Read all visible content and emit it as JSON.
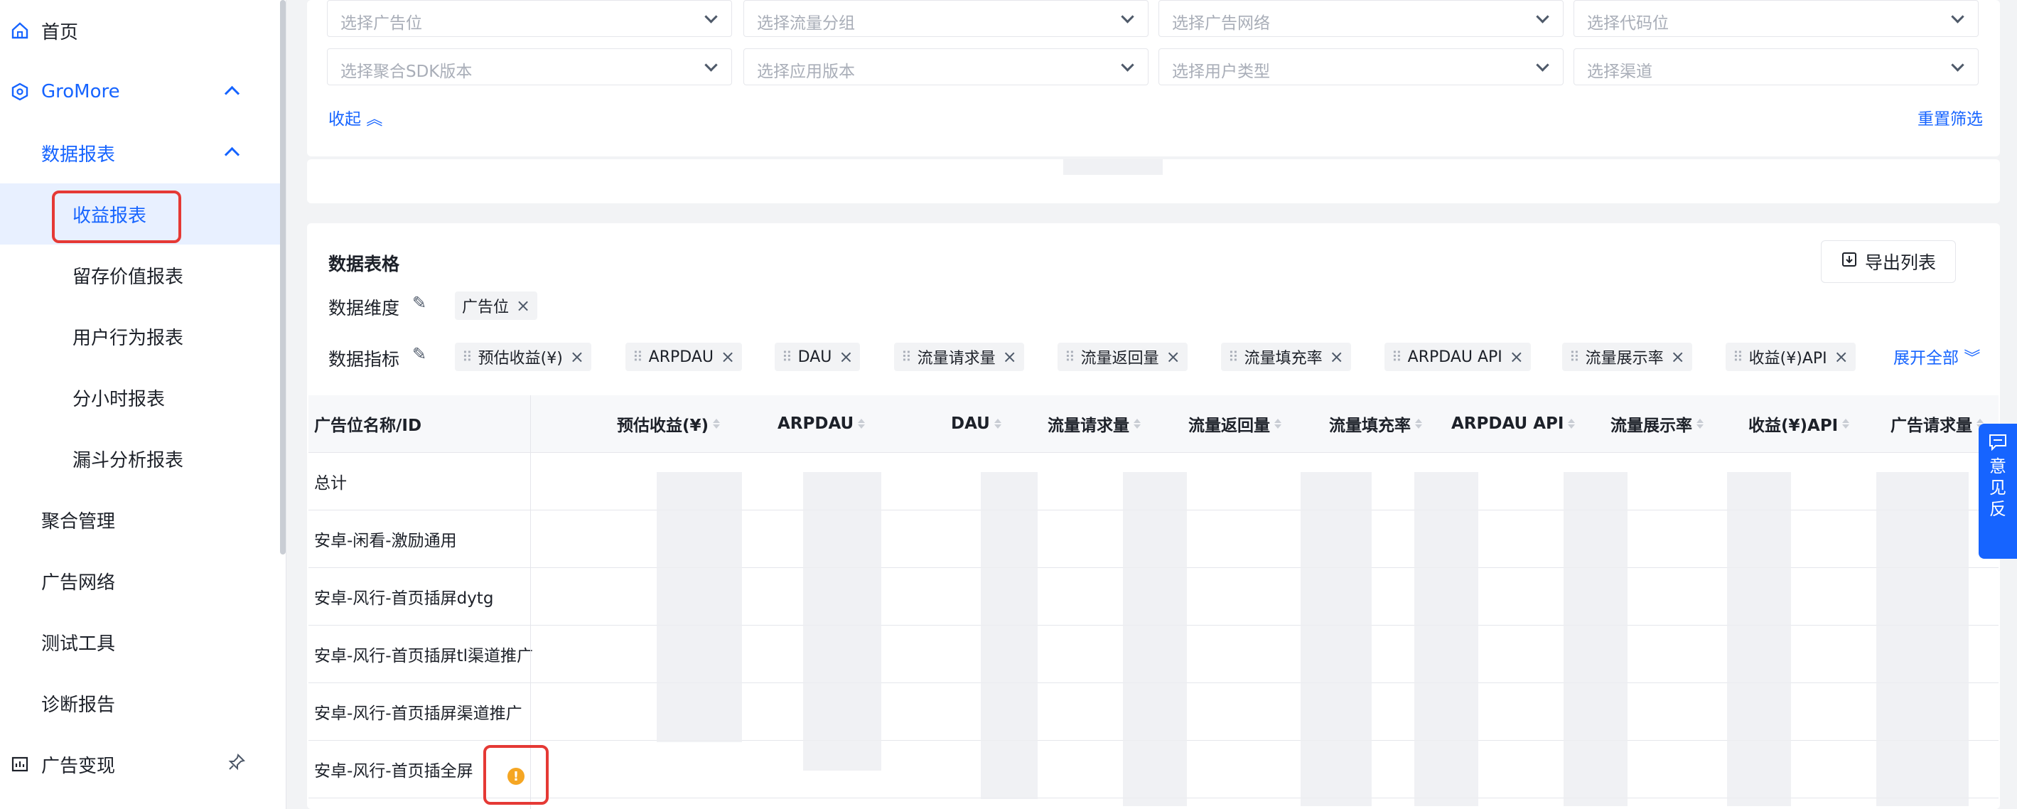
{
  "sidebar": {
    "home": "首页",
    "gromore": "GroMore",
    "data_reports": "数据报表",
    "income_report": "收益报表",
    "retention_report": "留存价值报表",
    "user_behavior_report": "用户行为报表",
    "hourly_report": "分小时报表",
    "funnel_report": "漏斗分析报表",
    "mediation": "聚合管理",
    "ad_network": "广告网络",
    "test_tools": "测试工具",
    "diagnosis": "诊断报告",
    "ad_monetization": "广告变现"
  },
  "filters": {
    "row1": [
      "选择广告位",
      "选择流量分组",
      "选择广告网络",
      "选择代码位"
    ],
    "row2": [
      "选择聚合SDK版本",
      "选择应用版本",
      "选择用户类型",
      "选择渠道"
    ],
    "collapse": "收起",
    "reset": "重置筛选"
  },
  "table_card": {
    "title": "数据表格",
    "export": "导出列表",
    "dimension_label": "数据维度",
    "dimension_tag": "广告位",
    "metric_label": "数据指标",
    "metrics": [
      "预估收益(¥)",
      "ARPDAU",
      "DAU",
      "流量请求量",
      "流量返回量",
      "流量填充率",
      "ARPDAU API",
      "流量展示率",
      "收益(¥)API"
    ],
    "expand_all": "展开全部"
  },
  "table": {
    "first_col": "广告位名称/ID",
    "columns": [
      "预估收益(¥)",
      "ARPDAU",
      "DAU",
      "流量请求量",
      "流量返回量",
      "流量填充率",
      "ARPDAU API",
      "流量展示率",
      "收益(¥)API",
      "广告请求量"
    ],
    "rows": [
      "总计",
      "安卓-闲看-激励通用",
      "安卓-风行-首页插屏dytg",
      "安卓-风行-首页插屏tl渠道推广",
      "安卓-风行-首页插屏渠道推广",
      "安卓-风行-首页插全屏"
    ]
  },
  "feedback": [
    "意",
    "见",
    "反"
  ],
  "colors": {
    "primary": "#1664ff",
    "highlight": "#e53935",
    "warning": "#f5a623"
  }
}
